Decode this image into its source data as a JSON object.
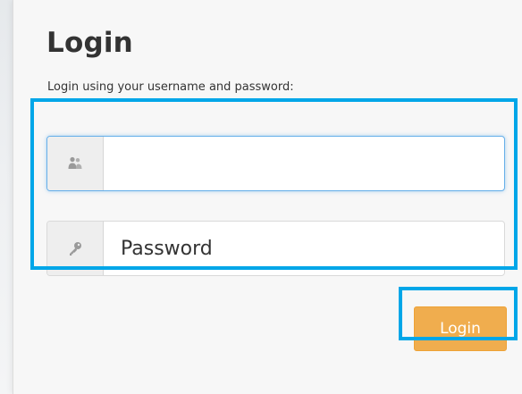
{
  "login": {
    "title": "Login",
    "subtitle": "Login using your username and password:",
    "username": {
      "value": "",
      "placeholder": "",
      "icon": "user-icon"
    },
    "password": {
      "value": "",
      "placeholder": "Password",
      "icon": "key-icon"
    },
    "submit_label": "Login"
  },
  "colors": {
    "accent_button": "#f0ad4e",
    "highlight_box": "#00a6e8",
    "focus_ring": "#66afe9",
    "text": "#333333"
  }
}
